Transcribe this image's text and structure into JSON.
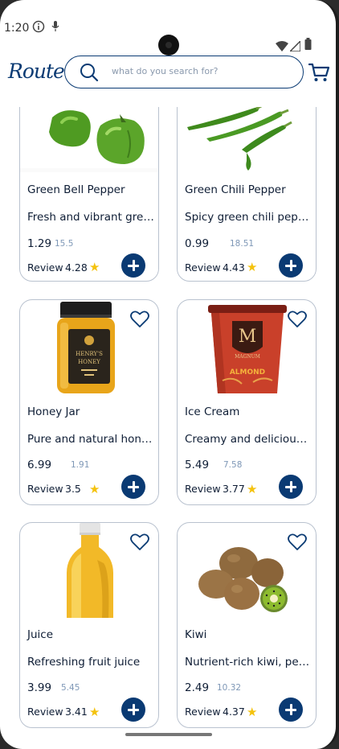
{
  "status": {
    "time": "1:20"
  },
  "header": {
    "logo": "Route",
    "search_placeholder": "what do you search for?"
  },
  "products": [
    {
      "name": "Green Bell Pepper",
      "desc": "Fresh and vibrant green bell peppers",
      "price": "1.29",
      "old_price": "15.5",
      "review_label": "Review",
      "rating": "4.28",
      "image": "green-bell-pepper"
    },
    {
      "name": "Green Chili Pepper",
      "desc": "Spicy green chili peppers",
      "price": "0.99",
      "old_price": "18.51",
      "review_label": "Review",
      "rating": "4.43",
      "image": "green-chili-pepper"
    },
    {
      "name": "Honey Jar",
      "desc": "Pure and natural honey",
      "price": "6.99",
      "old_price": "1.91",
      "review_label": "Review",
      "rating": "3.5",
      "image": "honey-jar",
      "jar_label_1": "HENRY'S",
      "jar_label_2": "HONEY"
    },
    {
      "name": "Ice Cream",
      "desc": "Creamy and delicious ice cream",
      "price": "5.49",
      "old_price": "7.58",
      "review_label": "Review",
      "rating": "3.77",
      "image": "ice-cream-tub",
      "tub_label_1": "MAGNUM",
      "tub_label_2": "ALMOND"
    },
    {
      "name": "Juice",
      "desc": "Refreshing fruit juice",
      "price": "3.99",
      "old_price": "5.45",
      "review_label": "Review",
      "rating": "3.41",
      "image": "juice-bottle"
    },
    {
      "name": "Kiwi",
      "desc": "Nutrient-rich kiwi, perfect",
      "price": "2.49",
      "old_price": "10.32",
      "review_label": "Review",
      "rating": "4.37",
      "image": "kiwi"
    }
  ],
  "colors": {
    "brand": "#0a3a73",
    "star": "#f4c20d",
    "old_price": "#7f98b7",
    "card_border": "#b9c2cf"
  }
}
